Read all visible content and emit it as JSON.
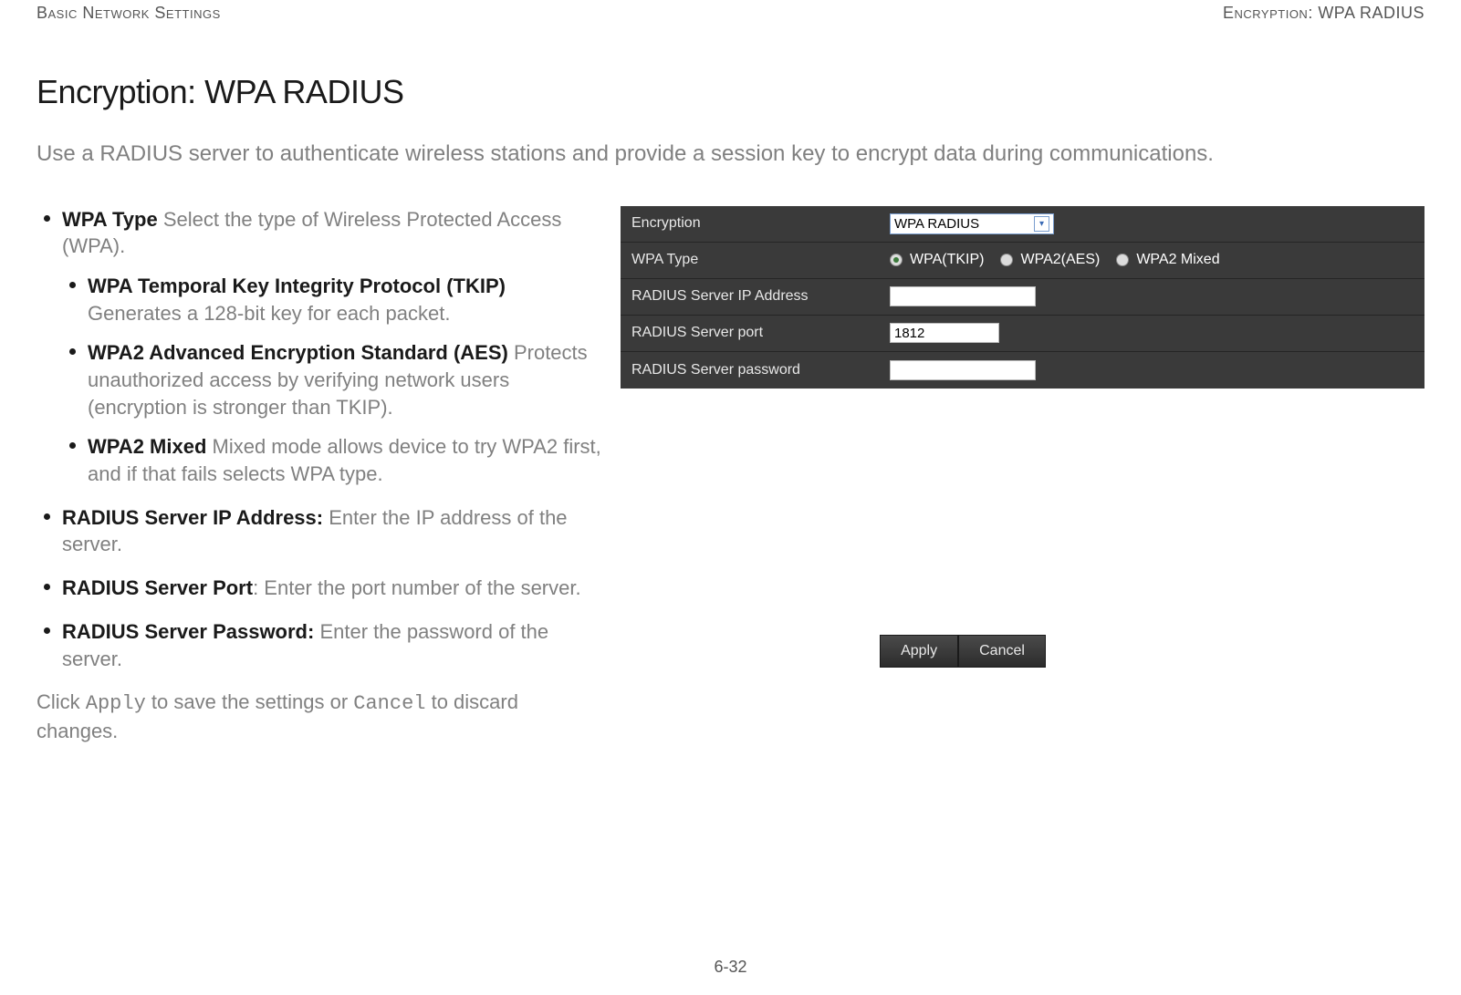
{
  "header": {
    "left": "Basic Network Settings",
    "right": "Encryption: WPA RADIUS"
  },
  "title": "Encryption: WPA RADIUS",
  "intro": "Use a RADIUS server to authenticate wireless stations and provide a session key to encrypt data during communications.",
  "bullets": {
    "wpaType": {
      "term": "WPA Type",
      "desc": "  Select the type of Wireless Protected Access (WPA)."
    },
    "tkip": {
      "term": "WPA Temporal Key Integrity Protocol (TKIP)",
      "desc": "  Generates a 128-bit key for each packet."
    },
    "aes": {
      "term": "WPA2 Advanced Encryption Standard (AES)",
      "desc": "  Protects unauthorized access by verifying network users (encryption is stronger than TKIP)."
    },
    "mixed": {
      "term": "WPA2 Mixed",
      "desc": "  Mixed mode allows device to try WPA2 first, and if that fails selects WPA type."
    },
    "ip": {
      "term": "RADIUS Server IP Address:",
      "desc": " Enter the IP address of the server."
    },
    "port": {
      "term": "RADIUS Server Port",
      "desc": ": Enter the port number of the server."
    },
    "pwd": {
      "term": "RADIUS Server Password:",
      "desc": " Enter the password of the server."
    }
  },
  "closing": {
    "pre": "Click ",
    "apply": "Apply",
    "mid": " to save the settings or ",
    "cancel": "Cancel",
    "post": " to discard changes."
  },
  "panel": {
    "rows": {
      "enc": {
        "label": "Encryption",
        "value": "WPA RADIUS"
      },
      "wtype": {
        "label": "WPA Type",
        "opt1": "WPA(TKIP)",
        "opt2": "WPA2(AES)",
        "opt3": "WPA2 Mixed"
      },
      "ip": {
        "label": "RADIUS Server IP Address",
        "value": ""
      },
      "port": {
        "label": "RADIUS Server port",
        "value": "1812"
      },
      "pwd": {
        "label": "RADIUS Server password",
        "value": ""
      }
    }
  },
  "buttons": {
    "apply": "Apply",
    "cancel": "Cancel"
  },
  "pageNum": "6-32"
}
